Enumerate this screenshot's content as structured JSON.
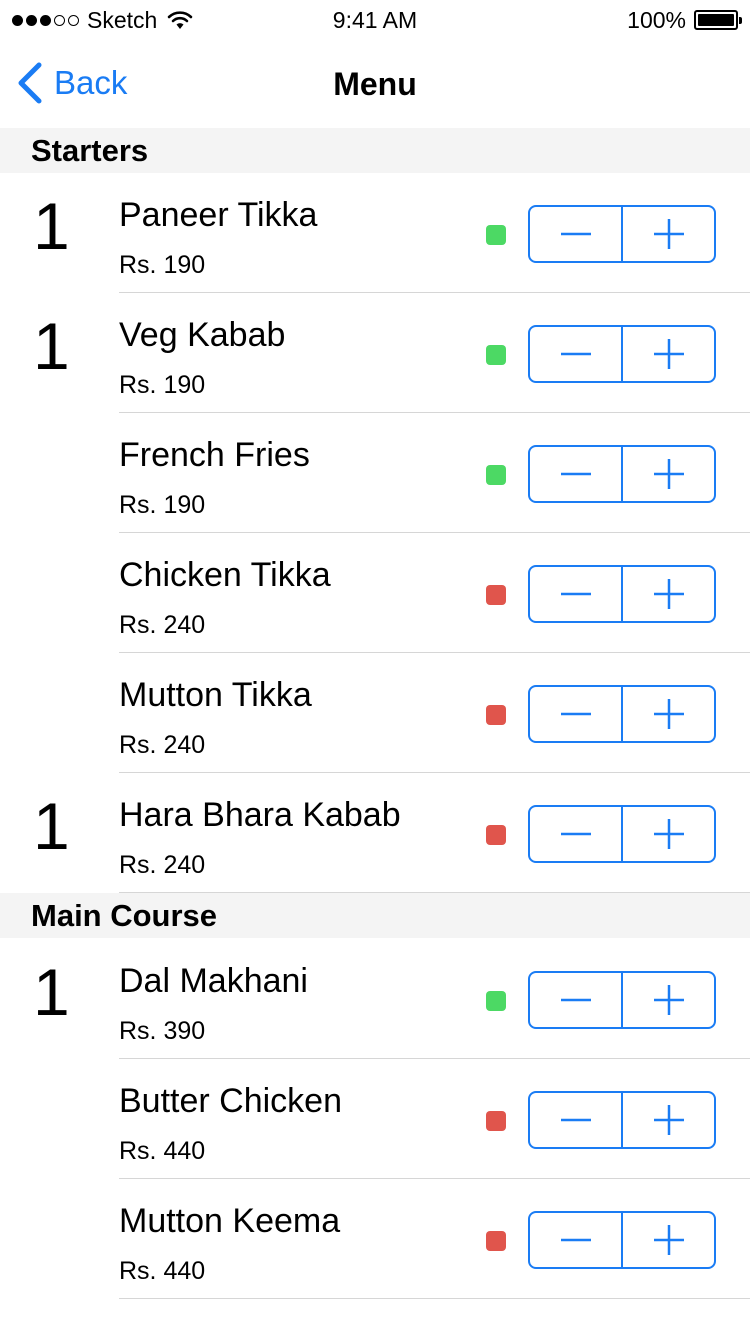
{
  "status_bar": {
    "carrier": "Sketch",
    "time": "9:41 AM",
    "battery": "100%",
    "signal_dots_filled": 3,
    "signal_dots_total": 5
  },
  "nav": {
    "back_label": "Back",
    "title": "Menu"
  },
  "colors": {
    "accent": "#1a7cf4",
    "veg": "#4cd964",
    "non_veg": "#e0554c",
    "section_bg": "#f4f4f4"
  },
  "icons": {
    "back": "chevron-left-icon",
    "minus": "minus-icon",
    "plus": "plus-icon",
    "wifi": "wifi-icon",
    "battery": "battery-icon"
  },
  "sections": [
    {
      "title": "Starters",
      "items": [
        {
          "qty": "1",
          "name": "Paneer Tikka",
          "price": "Rs. 190",
          "type": "veg"
        },
        {
          "qty": "1",
          "name": "Veg Kabab",
          "price": "Rs. 190",
          "type": "veg"
        },
        {
          "qty": "",
          "name": "French Fries",
          "price": "Rs. 190",
          "type": "veg"
        },
        {
          "qty": "",
          "name": "Chicken Tikka",
          "price": "Rs. 240",
          "type": "non_veg"
        },
        {
          "qty": "",
          "name": "Mutton Tikka",
          "price": "Rs. 240",
          "type": "non_veg"
        },
        {
          "qty": "1",
          "name": "Hara Bhara Kabab",
          "price": "Rs. 240",
          "type": "non_veg"
        }
      ]
    },
    {
      "title": "Main Course",
      "items": [
        {
          "qty": "1",
          "name": "Dal Makhani",
          "price": "Rs. 390",
          "type": "veg"
        },
        {
          "qty": "",
          "name": "Butter Chicken",
          "price": "Rs. 440",
          "type": "non_veg"
        },
        {
          "qty": "",
          "name": "Mutton Keema",
          "price": "Rs. 440",
          "type": "non_veg"
        }
      ]
    }
  ]
}
